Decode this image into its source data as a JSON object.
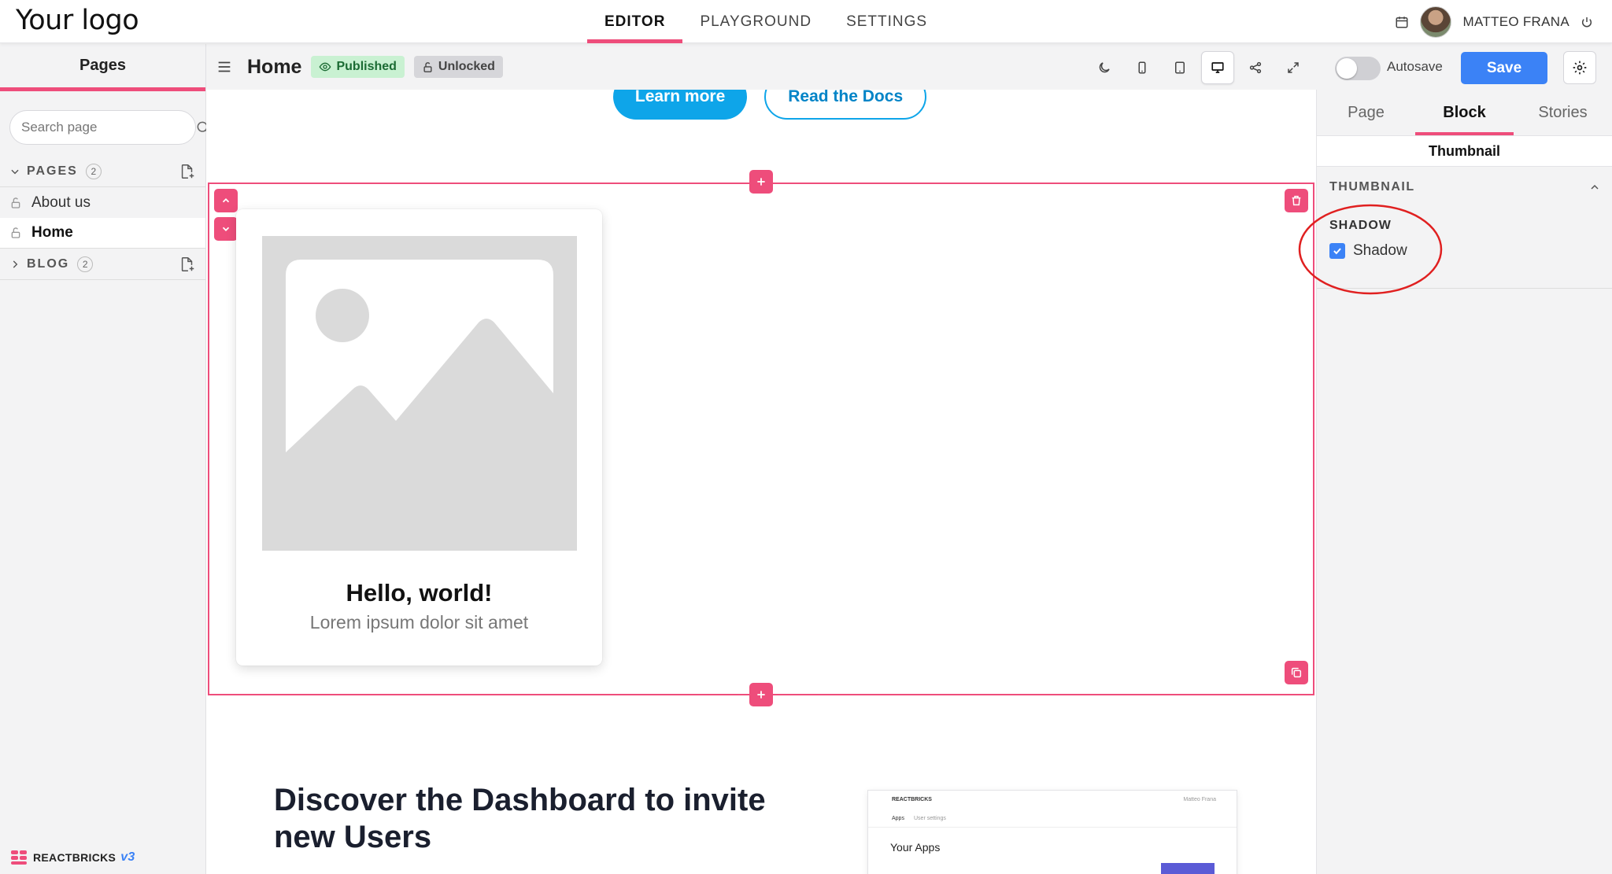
{
  "topbar": {
    "logo": "Your logo",
    "tabs": [
      {
        "label": "EDITOR",
        "active": true
      },
      {
        "label": "PLAYGROUND",
        "active": false
      },
      {
        "label": "SETTINGS",
        "active": false
      }
    ],
    "user_name": "MATTEO FRANA",
    "icons": [
      "calendar-icon",
      "power-icon"
    ]
  },
  "sidebar": {
    "title": "Pages",
    "search_placeholder": "Search page",
    "sections": [
      {
        "label": "PAGES",
        "count": "2",
        "expanded": true,
        "items": [
          {
            "label": "About us",
            "active": false
          },
          {
            "label": "Home",
            "active": true
          }
        ]
      },
      {
        "label": "BLOG",
        "count": "2",
        "expanded": false,
        "items": []
      }
    ],
    "brand": "REACTBRICKS",
    "brand_version": "v3"
  },
  "toolbar": {
    "page_name": "Home",
    "status_badge": "Published",
    "lock_badge": "Unlocked",
    "device_icons": [
      "dark-mode-icon",
      "mobile-icon",
      "tablet-icon",
      "desktop-icon",
      "share-icon",
      "fullscreen-icon"
    ],
    "active_device": "desktop-icon",
    "autosave_label": "Autosave",
    "autosave_on": false,
    "save_label": "Save"
  },
  "canvas": {
    "cta_primary": "Learn more",
    "cta_secondary": "Read the Docs",
    "card_title": "Hello, world!",
    "card_text": "Lorem ipsum dolor sit amet",
    "discover_title": "Discover the Dashboard to invite new Users",
    "mini_dashboard": {
      "brand": "REACTBRICKS",
      "user": "Matteo Frana",
      "tab_active": "Apps",
      "tab_other": "User settings",
      "title": "Your Apps"
    }
  },
  "right_panel": {
    "tabs": [
      {
        "label": "Page",
        "active": false
      },
      {
        "label": "Block",
        "active": true
      },
      {
        "label": "Stories",
        "active": false
      }
    ],
    "block_name": "Thumbnail",
    "section_title": "THUMBNAIL",
    "field_label": "SHADOW",
    "checkbox_label": "Shadow",
    "checkbox_checked": true
  },
  "colors": {
    "accent": "#ee4d7b",
    "primary": "#3b82f6",
    "cta": "#0ea5e9",
    "annotation": "#e02020"
  }
}
